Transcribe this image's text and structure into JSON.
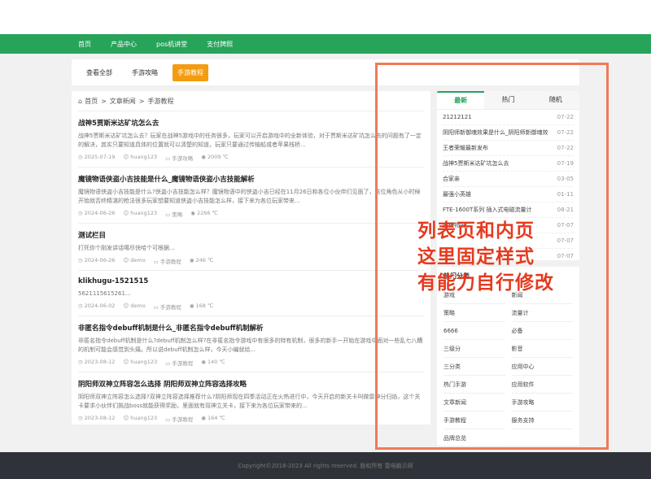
{
  "nav": [
    "首页",
    "产品中心",
    "pos机讲堂",
    "支付牌照"
  ],
  "filters": [
    {
      "label": "查看全部",
      "active": false
    },
    {
      "label": "手游攻略",
      "active": false
    },
    {
      "label": "手游教程",
      "active": true
    }
  ],
  "breadcrumb": [
    "首页",
    ">",
    "文章新闻",
    ">",
    "手游教程"
  ],
  "articles": [
    {
      "title": "战神5贾斯米达矿坑怎么去",
      "summary": "战神5贾斯米达矿坑怎么去？玩家在战神5游戏中的任务很多，玩家可以开启游戏中的全新体验，对于贾斯米达矿坑怎么去的问题有了一定的解决，其实只要知道具体的位置就可以清楚的知道，玩家只要通过传输船或者苹果栈桥...",
      "date": "2025-07-19",
      "author": "huang123",
      "category": "手游攻略",
      "views": "2009 ℃"
    },
    {
      "title": "魔镜物语侠盗小吉技能是什么_魔镜物语侠盗小吉技能解析",
      "summary": "魔镜物语侠盗小吉技能是什么?侠盗小吉技能怎么样？魔镜物语中的侠盗小吉已经在11月26日和各位小伙伴们见面了，这位角色从小时候开始就否终精湛的枪法很多玩家想要知道侠盗小吉技能怎么样，接下来为各位玩家带来...",
      "date": "2024-06-26",
      "author": "huang123",
      "category": "策略",
      "views": "2266 ℃"
    },
    {
      "title": "测试栏目",
      "summary": "打死你个刚发讲话噶尽快哈个可根据...",
      "date": "2024-06-26",
      "author": "demo",
      "category": "手游教程",
      "views": "246 ℃"
    },
    {
      "title": "klikhugu-1521515",
      "summary": "5621115615261...",
      "date": "2024-06-02",
      "author": "demo",
      "category": "手游教程",
      "views": "168 ℃"
    },
    {
      "title": "非匿名指令debuff机制是什么_非匿名指令debuff机制解析",
      "summary": "非匿名指令debuff机制是什么?debuff机制怎么样?在非匿名指令游戏中有很多的特有机制，很多的新手一开始在游戏中面对一些乱七八糟的机制可能会感觉到头痛。所以说debuff机制怎么样，今天小编就给...",
      "date": "2023-08-12",
      "author": "huang123",
      "category": "手游教程",
      "views": "140 ℃"
    },
    {
      "title": "阴阳师双神立阵容怎么选择 阴阳师双神立阵容选择攻略",
      "summary": "阴阳师双神立阵容怎么选择?双神立阵容选择推荐什么?阴阳师现在四季活动正在火热进行中，今天开启的新关卡叫做雷神分归焰，这个关卡要求小伙伴们挑战boss就能获得奖励，里面就有双神立关卡，接下来为各位玩家带来的...",
      "date": "2023-08-12",
      "author": "huang123",
      "category": "手游教程",
      "views": "164 ℃"
    }
  ],
  "sidebar_tabs": [
    {
      "label": "最新",
      "active": true
    },
    {
      "label": "热门",
      "active": false
    },
    {
      "label": "随机",
      "active": false
    }
  ],
  "latest": [
    {
      "title": "21212121",
      "date": "07-22"
    },
    {
      "title": "阴阳师新御魂效果是什么_阴阳师新御魂效",
      "date": "07-22"
    },
    {
      "title": "王者荣耀最新发布",
      "date": "07-22"
    },
    {
      "title": "战神5贾斯米达矿坑怎么去",
      "date": "07-19"
    },
    {
      "title": "合家亲",
      "date": "03-05"
    },
    {
      "title": "最强小英雄",
      "date": "01-11"
    },
    {
      "title": "FTE-1600T系列 插入式电磁流量计",
      "date": "08-21"
    },
    {
      "title": "魔镜物语",
      "date": "07-07"
    },
    {
      "title": "",
      "date": "07-07"
    },
    {
      "title": "",
      "date": "07-07"
    }
  ],
  "tag_title": "热门分类",
  "tags": [
    "游戏",
    "新闻",
    "策略",
    "流量计",
    "6666",
    "必备",
    "三级分",
    "影音",
    "三分类",
    "应用中心",
    "热门手游",
    "应用软件",
    "文章新闻",
    "手游攻略",
    "手游教程",
    "服务支持",
    "品牌总览"
  ],
  "overlay_lines": [
    "列表页和内页",
    "这里固定样式",
    "有能力自行修改"
  ],
  "footer": "Copyright©2018-2023 All rights reserved. 版权所有 靠电脑示网",
  "colors": {
    "brand": "#27a35a",
    "accent": "#f39c12",
    "annotation": "#e53a1e"
  }
}
